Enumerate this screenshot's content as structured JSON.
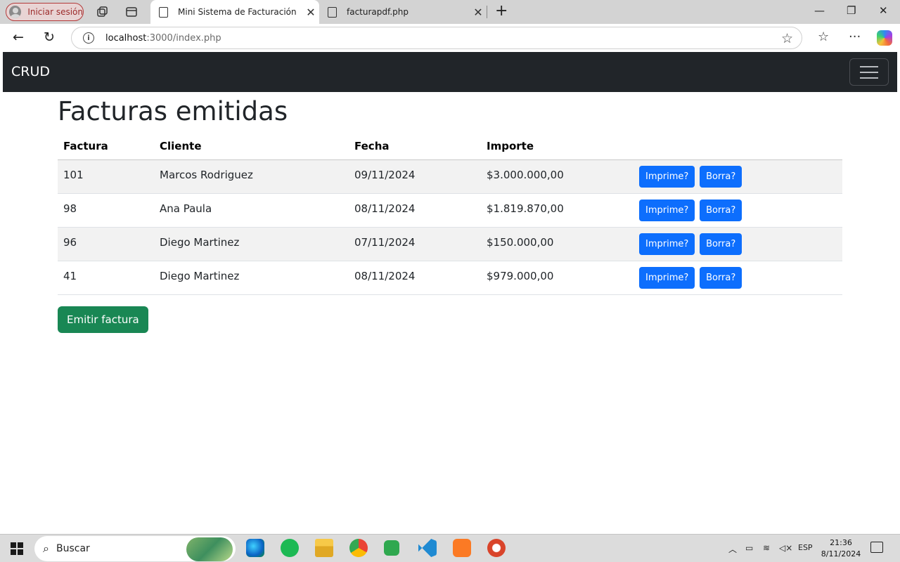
{
  "browser": {
    "profile_label": "Iniciar sesión",
    "tabs": [
      {
        "title": "Mini Sistema de Facturación",
        "active": true
      },
      {
        "title": "facturapdf.php",
        "active": false
      }
    ],
    "new_tab": "+",
    "url_host": "localhost",
    "url_rest": ":3000/index.php"
  },
  "navbar": {
    "brand": "CRUD"
  },
  "main": {
    "heading": "Facturas emitidas",
    "columns": [
      "Factura",
      "Cliente",
      "Fecha",
      "Importe",
      ""
    ],
    "rows": [
      {
        "factura": "101",
        "cliente": "Marcos Rodriguez",
        "fecha": "09/11/2024",
        "importe": "$3.000.000,00",
        "print_label": "Imprime?",
        "delete_label": "Borra?"
      },
      {
        "factura": "98",
        "cliente": "Ana Paula",
        "fecha": "08/11/2024",
        "importe": "$1.819.870,00",
        "print_label": "Imprime?",
        "delete_label": "Borra?"
      },
      {
        "factura": "96",
        "cliente": "Diego Martinez",
        "fecha": "07/11/2024",
        "importe": "$150.000,00",
        "print_label": "Imprime?",
        "delete_label": "Borra?"
      },
      {
        "factura": "41",
        "cliente": "Diego Martinez",
        "fecha": "08/11/2024",
        "importe": "$979.000,00",
        "print_label": "Imprime?",
        "delete_label": "Borra?"
      }
    ],
    "emit_button": "Emitir factura"
  },
  "taskbar": {
    "search_placeholder": "Buscar",
    "language": "ESP",
    "time": "21:36",
    "date": "8/11/2024"
  },
  "colors": {
    "navbar_bg": "#212529",
    "primary": "#0d6efd",
    "success": "#198754",
    "stripe": "#f2f2f2"
  },
  "icons": [
    "user-avatar-icon",
    "workspaces-icon",
    "tab-actions-icon",
    "document-icon",
    "close-icon",
    "minimize-icon",
    "restore-icon",
    "back-icon",
    "refresh-icon",
    "info-icon",
    "star-icon",
    "favorites-icon",
    "more-icon",
    "copilot-icon",
    "hamburger-icon",
    "windows-start-icon",
    "search-icon",
    "edge-icon",
    "spotify-icon",
    "file-explorer-icon",
    "chrome-icon",
    "dbeaver-icon",
    "vscode-icon",
    "xampp-icon",
    "app-icon",
    "chevron-up-icon",
    "battery-icon",
    "wifi-icon",
    "volume-muted-icon",
    "notifications-icon"
  ]
}
